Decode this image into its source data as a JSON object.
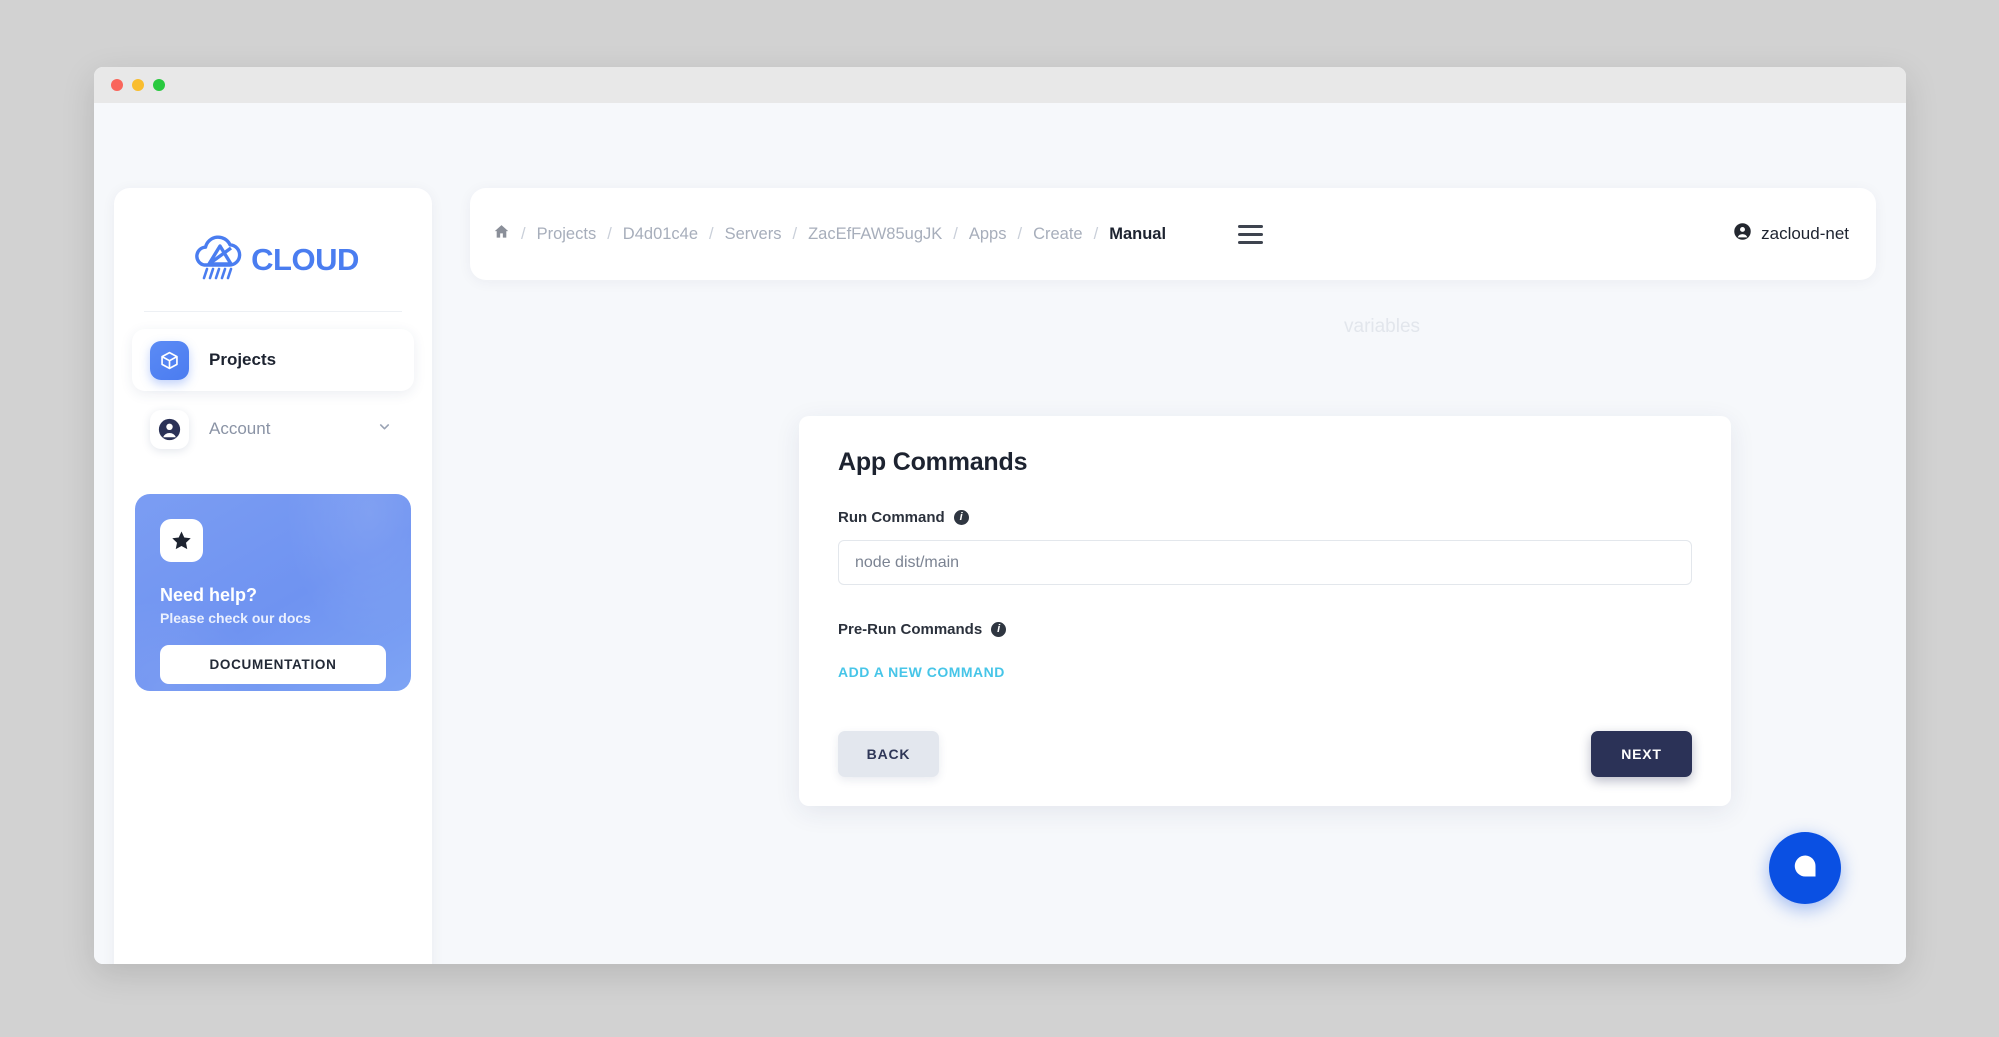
{
  "window": {
    "traffic_lights": [
      "close",
      "minimize",
      "maximize"
    ]
  },
  "sidebar": {
    "brand": {
      "word": "CLOUD",
      "icon": "zacloud-logo-icon"
    },
    "items": [
      {
        "label": "Projects",
        "icon": "cube-icon",
        "active": true
      },
      {
        "label": "Account",
        "icon": "user-circle-icon",
        "active": false,
        "chevron": "chevron-down-icon"
      }
    ],
    "help_card": {
      "icon": "star-icon",
      "title": "Need help?",
      "subtitle": "Please check our docs",
      "button_label": "DOCUMENTATION"
    }
  },
  "header": {
    "breadcrumb": [
      {
        "label": "home-icon",
        "type": "icon"
      },
      {
        "label": "Projects",
        "type": "link"
      },
      {
        "label": "D4d01c4e",
        "type": "link"
      },
      {
        "label": "Servers",
        "type": "link"
      },
      {
        "label": "ZacEfFAW85ugJK",
        "type": "link"
      },
      {
        "label": "Apps",
        "type": "link"
      },
      {
        "label": "Create",
        "type": "link"
      },
      {
        "label": "Manual",
        "type": "current"
      }
    ],
    "separator": "/",
    "menu_icon": "hamburger-menu-icon",
    "user": {
      "name": "zacloud-net",
      "icon": "user-circle-icon"
    }
  },
  "background": {
    "ghost_step_label": "variables"
  },
  "main": {
    "card": {
      "title": "App Commands",
      "run_command": {
        "label": "Run Command",
        "info_icon": "info-icon",
        "value": "",
        "placeholder": "node dist/main"
      },
      "pre_run_commands": {
        "label": "Pre-Run Commands",
        "info_icon": "info-icon",
        "add_link_label": "ADD A NEW COMMAND"
      },
      "actions": {
        "back_label": "BACK",
        "next_label": "NEXT"
      }
    }
  },
  "chat_widget": {
    "icon": "chat-bubble-icon"
  },
  "colors": {
    "brand_blue": "#4a7df0",
    "accent_cyan": "#46c5e8",
    "primary_dark": "#2b3257",
    "help_card_blue": "#7b9df3",
    "chat_blue": "#0a50e3"
  }
}
